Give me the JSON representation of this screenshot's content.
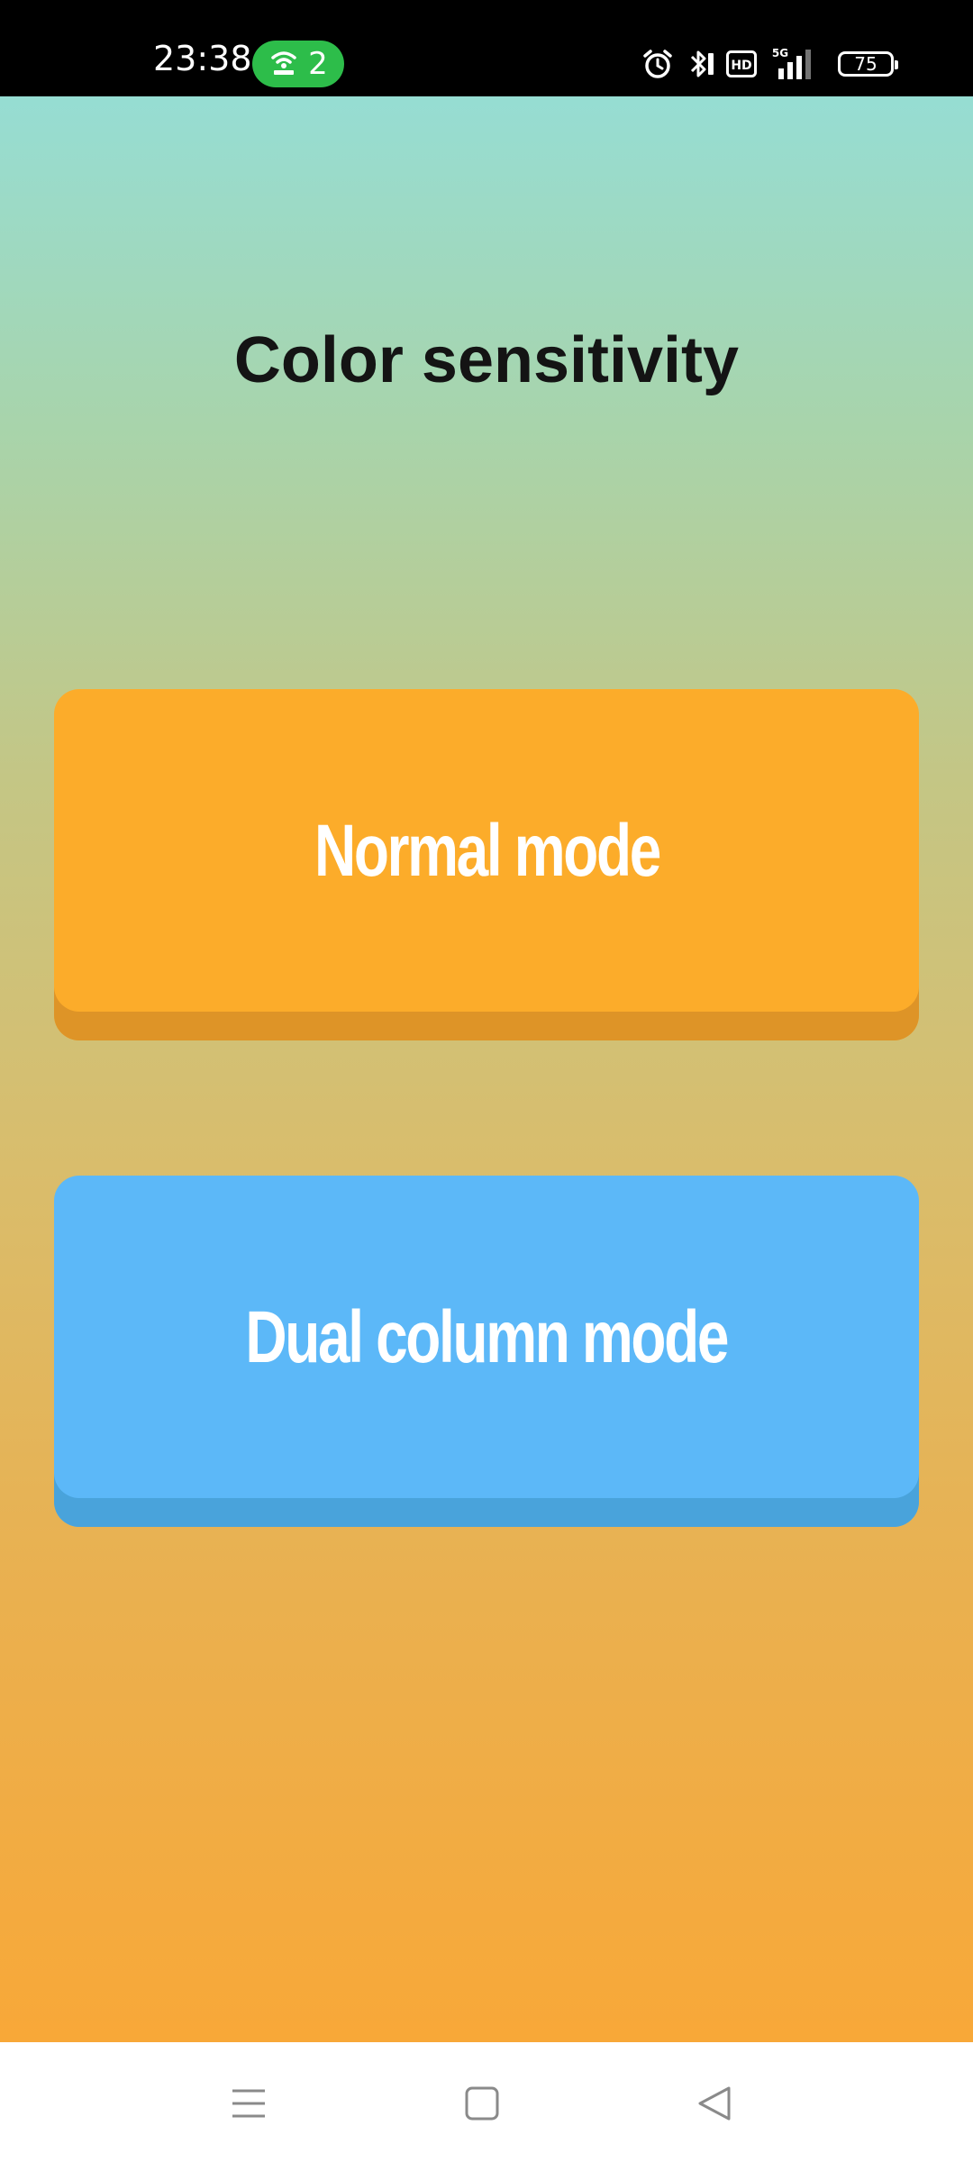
{
  "status_bar": {
    "time": "23:38",
    "hotspot_count": "2",
    "network_type": "5G",
    "hd_badge": "HD",
    "battery_level": "75",
    "icons": [
      "hotspot-icon",
      "alarm-icon",
      "bluetooth-icon",
      "hd-icon",
      "signal-icon",
      "battery-icon"
    ]
  },
  "main": {
    "title": "Color sensitivity",
    "buttons": [
      {
        "label": "Normal mode",
        "color": "#fcac2a",
        "shadow_color": "#de9427"
      },
      {
        "label": "Dual column mode",
        "color": "#5cb8f8",
        "shadow_color": "#49a3db"
      }
    ]
  },
  "nav_bar": {
    "icons": [
      "menu-icon",
      "home-icon",
      "back-icon"
    ]
  },
  "colors": {
    "gradient_top": "#96ddd3",
    "gradient_bottom": "#f8a838",
    "hotspot_pill": "#2dbd4a"
  }
}
